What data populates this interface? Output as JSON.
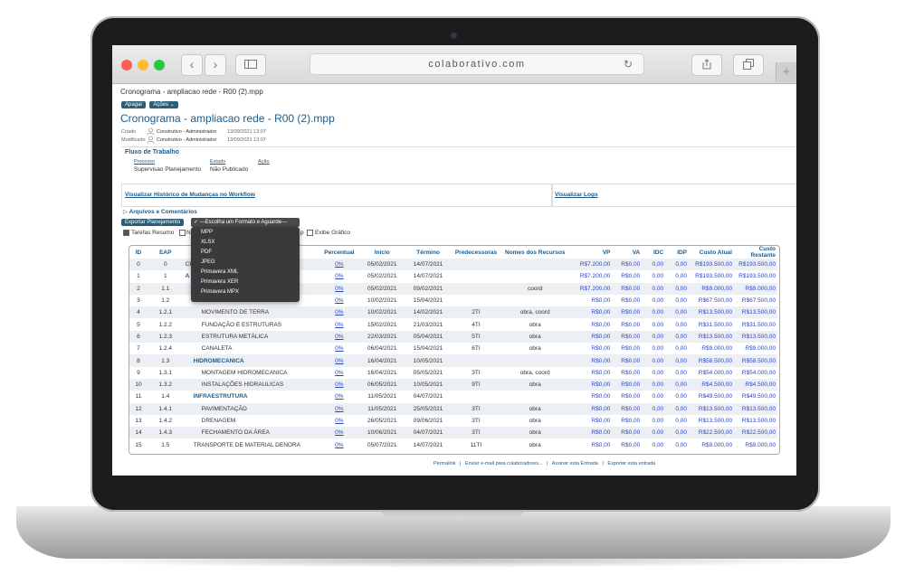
{
  "browser": {
    "url": "colaborativo.com"
  },
  "page": {
    "breadcrumb": "Cronograma - ampliacao rede - R00 (2).mpp",
    "btn_apagar": "Apagar",
    "btn_acoes": "Ações",
    "title": "Cronograma - ampliacao rede - R00 (2).mpp",
    "criado_label": "Criado",
    "criado_user": "Construtivo - Administrador",
    "criado_date": "13/09/2021 13:07",
    "modificado_label": "Modificado",
    "modificado_user": "Construtivo - Administrador",
    "modificado_date": "13/09/2021 13:07"
  },
  "workflow": {
    "title": "Fluxo de Trabalho",
    "col_processo": "Processo",
    "col_estado": "Estado",
    "col_acao": "Ação",
    "processo": "Supervisao Planejamento",
    "estado": "Não Publicado"
  },
  "links": {
    "historico": "Visualizar Histórico de Mudanças no Workflow",
    "logs": "Visualizar Logs",
    "arquivos": "Arquivos e Comentários"
  },
  "export": {
    "button": "Exportar Planejamento",
    "selected": "✓ ---Escolha um Formato e Aguarde---",
    "options": [
      "MPP",
      "XLSX",
      "PDF",
      "JPEG",
      "Primavera XML",
      "Primavera XER",
      "Primavera MPX"
    ]
  },
  "options": {
    "tarefas_resumo": "Tarefas Resumo",
    "partial_m": "N",
    "partial_p": "p",
    "exibe_grafico": "Exibe Gráfico"
  },
  "table": {
    "headers": [
      "ID",
      "EAP",
      "",
      "Percentual",
      "Início",
      "Término",
      "Predecessoras",
      "Nomes dos Recursos",
      "VP",
      "VA",
      "IDC",
      "IDP",
      "Custo Atual",
      "Custo Restante"
    ],
    "rows": [
      {
        "id": "0",
        "eap": "0",
        "name": "CRO",
        "pct": "0%",
        "ini": "05/02/2021",
        "fim": "14/07/2021",
        "pred": "",
        "rec": "",
        "vp": "R$7.200,00",
        "va": "R$0,00",
        "idc": "0,00",
        "idp": "0,00",
        "ca": "R$193.500,00",
        "cr": "R$193.500,00",
        "bold": false,
        "indent": 0
      },
      {
        "id": "1",
        "eap": "1",
        "name": "A",
        "pct": "0%",
        "ini": "05/02/2021",
        "fim": "14/07/2021",
        "pred": "",
        "rec": "",
        "vp": "R$7.200,00",
        "va": "R$0,00",
        "idc": "0,00",
        "idp": "0,00",
        "ca": "R$193.500,00",
        "cr": "R$193.500,00",
        "bold": true,
        "indent": 0
      },
      {
        "id": "2",
        "eap": "1.1",
        "name": "",
        "pct": "0%",
        "ini": "05/02/2021",
        "fim": "09/02/2021",
        "pred": "",
        "rec": "coord",
        "vp": "R$7.200,00",
        "va": "R$0,00",
        "idc": "0,00",
        "idp": "0,00",
        "ca": "R$9.000,00",
        "cr": "R$9.000,00",
        "bold": false,
        "indent": 0
      },
      {
        "id": "3",
        "eap": "1.2",
        "name": "",
        "pct": "0%",
        "ini": "10/02/2021",
        "fim": "15/04/2021",
        "pred": "",
        "rec": "",
        "vp": "R$0,00",
        "va": "R$0,00",
        "idc": "0,00",
        "idp": "0,00",
        "ca": "R$67.500,00",
        "cr": "R$67.500,00",
        "bold": false,
        "indent": 0
      },
      {
        "id": "4",
        "eap": "1.2.1",
        "name": "MOVIMENTO DE TERRA",
        "pct": "0%",
        "ini": "10/02/2021",
        "fim": "14/02/2021",
        "pred": "2TI",
        "rec": "obra, coord",
        "vp": "R$0,00",
        "va": "R$0,00",
        "idc": "0,00",
        "idp": "0,00",
        "ca": "R$13.500,00",
        "cr": "R$13.500,00",
        "bold": false,
        "indent": 2
      },
      {
        "id": "5",
        "eap": "1.2.2",
        "name": "FUNDAÇÃO E ESTRUTURAS",
        "pct": "0%",
        "ini": "15/02/2021",
        "fim": "21/03/2021",
        "pred": "4TI",
        "rec": "obra",
        "vp": "R$0,00",
        "va": "R$0,00",
        "idc": "0,00",
        "idp": "0,00",
        "ca": "R$31.500,00",
        "cr": "R$31.500,00",
        "bold": false,
        "indent": 2
      },
      {
        "id": "6",
        "eap": "1.2.3",
        "name": "ESTRUTURA METÁLICA",
        "pct": "0%",
        "ini": "22/03/2021",
        "fim": "05/04/2021",
        "pred": "5TI",
        "rec": "obra",
        "vp": "R$0,00",
        "va": "R$0,00",
        "idc": "0,00",
        "idp": "0,00",
        "ca": "R$13.500,00",
        "cr": "R$13.500,00",
        "bold": false,
        "indent": 2
      },
      {
        "id": "7",
        "eap": "1.2.4",
        "name": "CANALETA",
        "pct": "0%",
        "ini": "06/04/2021",
        "fim": "15/04/2021",
        "pred": "6TI",
        "rec": "obra",
        "vp": "R$0,00",
        "va": "R$0,00",
        "idc": "0,00",
        "idp": "0,00",
        "ca": "R$9.000,00",
        "cr": "R$9.000,00",
        "bold": false,
        "indent": 2
      },
      {
        "id": "8",
        "eap": "1.3",
        "name": "HIDROMECANICA",
        "pct": "0%",
        "ini": "16/04/2021",
        "fim": "10/05/2021",
        "pred": "",
        "rec": "",
        "vp": "R$0,00",
        "va": "R$0,00",
        "idc": "0,00",
        "idp": "0,00",
        "ca": "R$58.500,00",
        "cr": "R$58.500,00",
        "bold": true,
        "indent": 1
      },
      {
        "id": "9",
        "eap": "1.3.1",
        "name": "MONTAGEM HIDROMECANICA",
        "pct": "0%",
        "ini": "16/04/2021",
        "fim": "05/05/2021",
        "pred": "3TI",
        "rec": "obra, coord",
        "vp": "R$0,00",
        "va": "R$0,00",
        "idc": "0,00",
        "idp": "0,00",
        "ca": "R$54.000,00",
        "cr": "R$54.000,00",
        "bold": false,
        "indent": 2
      },
      {
        "id": "10",
        "eap": "1.3.2",
        "name": "INSTALAÇÕES HIDRAULICAS",
        "pct": "0%",
        "ini": "06/05/2021",
        "fim": "10/05/2021",
        "pred": "9TI",
        "rec": "obra",
        "vp": "R$0,00",
        "va": "R$0,00",
        "idc": "0,00",
        "idp": "0,00",
        "ca": "R$4.500,00",
        "cr": "R$4.500,00",
        "bold": false,
        "indent": 2
      },
      {
        "id": "11",
        "eap": "1.4",
        "name": "INFRAESTRUTURA",
        "pct": "0%",
        "ini": "11/05/2021",
        "fim": "04/07/2021",
        "pred": "",
        "rec": "",
        "vp": "R$0,00",
        "va": "R$0,00",
        "idc": "0,00",
        "idp": "0,00",
        "ca": "R$49.500,00",
        "cr": "R$49.500,00",
        "bold": true,
        "indent": 1
      },
      {
        "id": "12",
        "eap": "1.4.1",
        "name": "PAVIMENTAÇÃO",
        "pct": "0%",
        "ini": "11/05/2021",
        "fim": "25/05/2021",
        "pred": "3TI",
        "rec": "obra",
        "vp": "R$0,00",
        "va": "R$0,00",
        "idc": "0,00",
        "idp": "0,00",
        "ca": "R$13.500,00",
        "cr": "R$13.500,00",
        "bold": false,
        "indent": 2
      },
      {
        "id": "13",
        "eap": "1.4.2",
        "name": "DRENAGEM",
        "pct": "0%",
        "ini": "26/05/2021",
        "fim": "09/06/2021",
        "pred": "3TI",
        "rec": "obra",
        "vp": "R$0,00",
        "va": "R$0,00",
        "idc": "0,00",
        "idp": "0,00",
        "ca": "R$13.500,00",
        "cr": "R$13.500,00",
        "bold": false,
        "indent": 2
      },
      {
        "id": "14",
        "eap": "1.4.3",
        "name": "FECHAMENTO DA ÁREA",
        "pct": "0%",
        "ini": "10/06/2021",
        "fim": "04/07/2021",
        "pred": "3TI",
        "rec": "obra",
        "vp": "R$0,00",
        "va": "R$0,00",
        "idc": "0,00",
        "idp": "0,00",
        "ca": "R$22.500,00",
        "cr": "R$22.500,00",
        "bold": false,
        "indent": 2
      },
      {
        "id": "15",
        "eap": "1.5",
        "name": "TRANSPORTE DE MATERIAL DENORA",
        "pct": "0%",
        "ini": "05/07/2021",
        "fim": "14/07/2021",
        "pred": "11TI",
        "rec": "obra",
        "vp": "R$0,00",
        "va": "R$0,00",
        "idc": "0,00",
        "idp": "0,00",
        "ca": "R$9.000,00",
        "cr": "R$9.000,00",
        "bold": false,
        "indent": 1
      }
    ]
  },
  "footer": {
    "permalink": "Permalink",
    "email": "Enviar e-mail para colaboradores...",
    "assinar": "Assinar esta Entrada",
    "exportar": "Exportar esta entrada",
    "sep": "|"
  }
}
